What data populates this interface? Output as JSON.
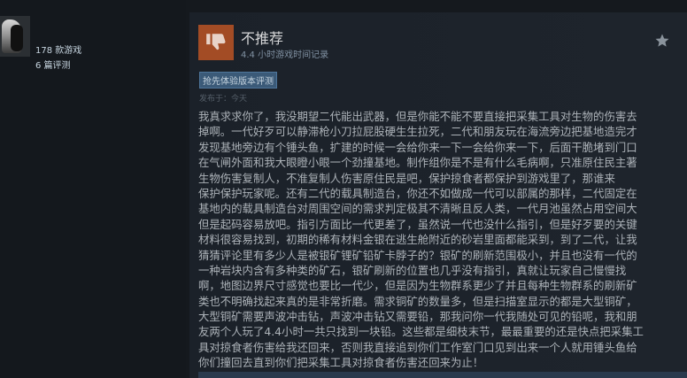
{
  "profile": {
    "games_count": "178 款游戏",
    "reviews_count": "6 篇评测"
  },
  "review": {
    "verdict": "不推荐",
    "hours": "4.4 小时游戏时间记录",
    "badge": "抢先体验版本评测",
    "posted": "发布于：今天",
    "lines": [
      "我真求求你了，我没期望二代能出武器，但是你能不能不要直接把采集工具对生物的伤害去",
      "掉啊。一代好歹可以静滞枪小刀拉屁股硬生生拉死，二代和朋友玩在海流旁边把基地造完才",
      "发现基地旁边有个锤头鱼，扩建的时候一会给你来一下一会给你来一下，后面干脆堵到门口",
      "在气闸外面和我大眼瞪小眼一个劲撞基地。制作组你是不是有什么毛病啊，只准原住民主著",
      "生物伤害复制人，不准复制人伤害原住民是吧，保护掠食者都保护到游戏里了，那谁来",
      "保护保护玩家呢。还有二代的载具制造台，你还不如做成一代可以部属的那样，二代固定在",
      "基地内的载具制造台对周围空间的需求判定极其不清晰且反人类，一代月池虽然占用空间大",
      "但是起码容易放吧。指引方面比一代更差了，虽然说一代也没什么指引，但是好歹要的关键",
      "材料很容易找到，初期的稀有材料金银在逃生舱附近的砂岩里面都能采到，到了二代，让我",
      "猜猜评论里有多少人是被银矿锂矿铅矿卡脖子的？银矿的刷新范围极小，并且也没有一代的",
      "一种岩块内含有多种类的矿石，银矿刷新的位置也几乎没有指引，真就让玩家自己慢慢找",
      "啊，地图边界尺寸感觉也要比一代少，但是因为生物群系更少了并且每种生物群系的刷新矿",
      "类也不明确找起来真的是非常折磨。需求铜矿的数量多，但是扫描室显示的都是大型铜矿，",
      "大型铜矿需要声波冲击钻，声波冲击钻又需要铅，那我问你一代我随处可见的铅呢，我和朋",
      "友两个人玩了4.4小时一共只找到一块铅。这些都是细枝末节，最最重要的还是快点把采集工",
      "具对掠食者伤害给我还回来，否则我直接追到你们工作室门口见到出来一个人就用锤头鱼给",
      "你们撞回去直到你们把采集工具对掠食者伤害还回来为止！"
    ]
  },
  "colors": {
    "negative_thumb": "#a34c25",
    "badge_bg": "#3b5a78"
  },
  "icons": {
    "thumb": "thumbs-down-icon",
    "star": "star-icon"
  }
}
